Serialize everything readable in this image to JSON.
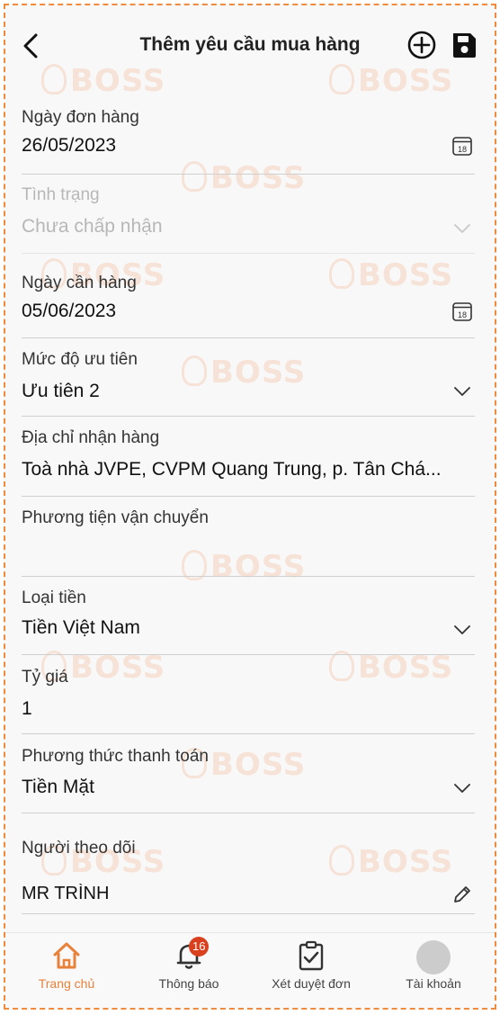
{
  "header": {
    "title": "Thêm yêu cầu mua hàng"
  },
  "watermark": "BOSS",
  "form": {
    "order_date": {
      "label": "Ngày đơn hàng",
      "value": "26/05/2023",
      "calendar_day": "18"
    },
    "status": {
      "label": "Tình trạng",
      "value": "Chưa chấp nhận"
    },
    "need_date": {
      "label": "Ngày cần hàng",
      "value": "05/06/2023",
      "calendar_day": "18"
    },
    "priority": {
      "label": "Mức độ ưu tiên",
      "value": "Ưu tiên 2"
    },
    "address": {
      "label": "Địa chỉ nhận hàng",
      "value": "Toà nhà JVPE, CVPM Quang Trung, p. Tân Chá..."
    },
    "transport": {
      "label": "Phương tiện vận chuyển",
      "value": ""
    },
    "currency": {
      "label": "Loại tiền",
      "value": "Tiền Việt Nam"
    },
    "rate": {
      "label": "Tỷ giá",
      "value": "1"
    },
    "payment": {
      "label": "Phương thức thanh toán",
      "value": "Tiền Mặt"
    },
    "follower": {
      "label": "Người theo dõi",
      "value": "MR TRÌNH"
    }
  },
  "tabbar": {
    "home": {
      "label": "Trang chủ"
    },
    "notifications": {
      "label": "Thông báo",
      "badge": "16"
    },
    "approve": {
      "label": "Xét duyệt đơn"
    },
    "account": {
      "label": "Tài khoản"
    }
  },
  "colors": {
    "accent": "#e8813a",
    "badge": "#d9411e",
    "border_dash": "#f08a3c"
  }
}
